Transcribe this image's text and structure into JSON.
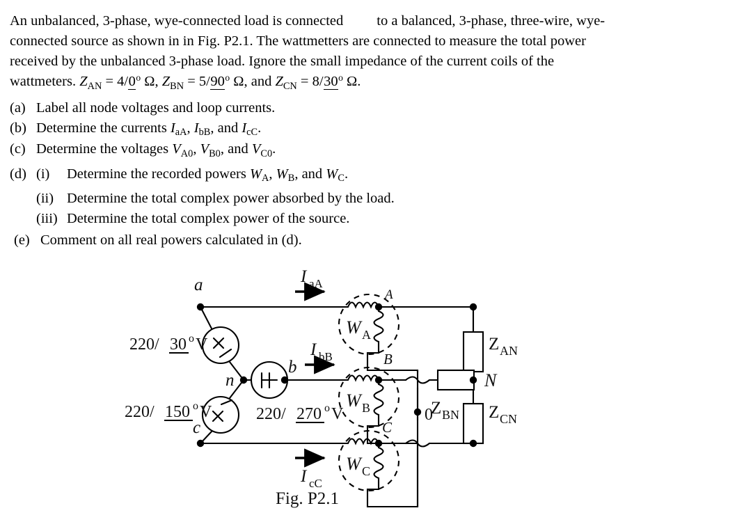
{
  "problem": {
    "line1_a": "An unbalanced, 3-phase, wye-connected load is connected",
    "line1_b": "to a balanced, 3-phase, three-wire, wye-",
    "line2": "connected source as shown in in Fig. P2.1. The wattmetters are connected to measure the total power",
    "line3": "received by the unbalanced 3-phase load. Ignore the small impedance   of   the   current   coils   of   the",
    "line4_pre": "wattmeters. ",
    "z_an_sym": "Z",
    "z_an_sub": "AN",
    "eq1": " = 4/",
    "z_an_ang": "0",
    "deg": "o",
    "ohm1": " Ω, ",
    "z_bn_sym": "Z",
    "z_bn_sub": "BN",
    "eq2": " = 5/",
    "z_bn_ang": "90",
    "ohm2": " Ω, and ",
    "z_cn_sym": "Z",
    "z_cn_sub": "CN",
    "eq3": " = 8/",
    "z_cn_ang": "30",
    "ohm3": " Ω."
  },
  "items": [
    {
      "marker": "(a)",
      "text": "Label all node voltages and loop currents."
    },
    {
      "marker": "(b)",
      "pre": "Determine the currents ",
      "sym1": "I",
      "sub1": "aA",
      "s1": ", ",
      "sym2": "I",
      "sub2": "bB",
      "s2": ", and ",
      "sym3": "I",
      "sub3": "cC",
      "s3": "."
    },
    {
      "marker": "(c)",
      "pre": "Determine the voltages ",
      "sym1": "V",
      "sub1": "A0",
      "s1": ", ",
      "sym2": "V",
      "sub2": "B0",
      "s2": ", and ",
      "sym3": "V",
      "sub3": "C0",
      "s3": "."
    },
    {
      "marker": "(d)",
      "sub_marker": "(i)",
      "pre": "Determine the recorded powers ",
      "sym1": "W",
      "sub1": "A",
      "s1": ", ",
      "sym2": "W",
      "sub2": "B",
      "s2": ", and ",
      "sym3": "W",
      "sub3": "C",
      "s3": "."
    },
    {
      "marker": "",
      "sub_marker": "(ii)",
      "text": "Determine the total complex power absorbed by the load."
    },
    {
      "marker": "",
      "sub_marker": "(iii)",
      "text": "Determine the total complex power of the source."
    },
    {
      "marker": "(e)",
      "text": "Comment on all real powers calculated in (d)."
    }
  ],
  "figure": {
    "caption": "Fig. P2.1",
    "nodes": {
      "a": "a",
      "b": "b",
      "c": "c",
      "n": "n",
      "N": "N",
      "zero": "0"
    },
    "sources": [
      {
        "label_num": "220/",
        "label_ang": "30",
        "deg": "o",
        "unit": " V",
        "symbol": "ac-source-x"
      },
      {
        "label_num": "220/",
        "label_ang": "150",
        "deg": "o",
        "unit": " V",
        "symbol": "ac-source-x"
      },
      {
        "label_num": "220/",
        "label_ang": "270",
        "deg": "o",
        "unit": " V",
        "symbol": "dc-source-plus"
      }
    ],
    "currents": [
      {
        "sym": "I",
        "sub": "aA"
      },
      {
        "sym": "I",
        "sub": "bB"
      },
      {
        "sym": "I",
        "sub": "cC"
      }
    ],
    "wattmeters": [
      {
        "sym": "W",
        "sub": "A",
        "tag": "A"
      },
      {
        "sym": "W",
        "sub": "B",
        "tag": "B"
      },
      {
        "sym": "W",
        "sub": "C",
        "tag": "C"
      }
    ],
    "impedances": [
      {
        "sym": "Z",
        "sub": "AN"
      },
      {
        "sym": "Z",
        "sub": "BN"
      },
      {
        "sym": "Z",
        "sub": "CN"
      }
    ]
  },
  "colors": {
    "ink": "#000000",
    "label_ink": "#111111",
    "background": "#ffffff"
  }
}
